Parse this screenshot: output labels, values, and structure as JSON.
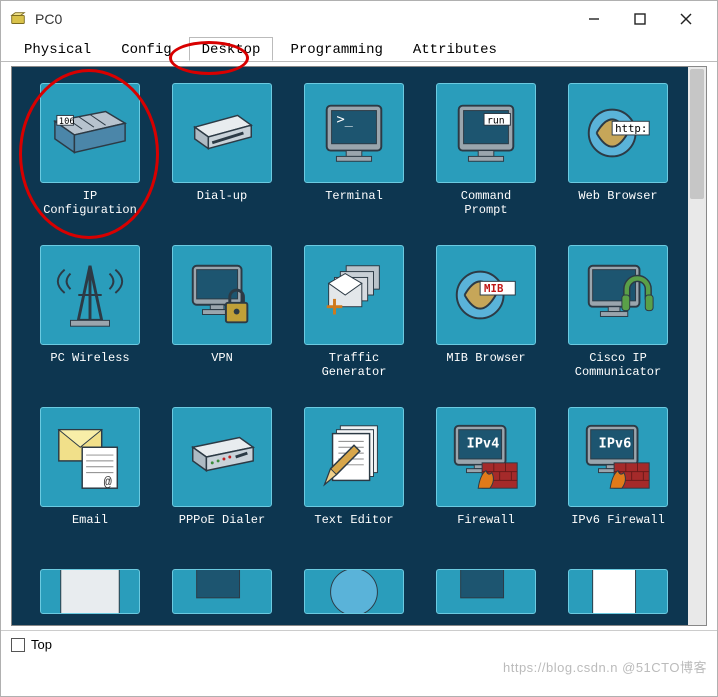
{
  "window": {
    "title": "PC0"
  },
  "tabs": [
    {
      "label": "Physical"
    },
    {
      "label": "Config"
    },
    {
      "label": "Desktop"
    },
    {
      "label": "Programming"
    },
    {
      "label": "Attributes"
    }
  ],
  "active_tab_index": 2,
  "apps": [
    {
      "label": "IP\nConfiguration",
      "icon": "ip-config"
    },
    {
      "label": "Dial-up",
      "icon": "dialup"
    },
    {
      "label": "Terminal",
      "icon": "terminal"
    },
    {
      "label": "Command\nPrompt",
      "icon": "cmd"
    },
    {
      "label": "Web Browser",
      "icon": "browser"
    },
    {
      "label": "PC Wireless",
      "icon": "wireless"
    },
    {
      "label": "VPN",
      "icon": "vpn"
    },
    {
      "label": "Traffic Generator",
      "icon": "traffic"
    },
    {
      "label": "MIB Browser",
      "icon": "mib"
    },
    {
      "label": "Cisco IP\nCommunicator",
      "icon": "ipcomm"
    },
    {
      "label": "Email",
      "icon": "email"
    },
    {
      "label": "PPPoE Dialer",
      "icon": "pppoe"
    },
    {
      "label": "Text Editor",
      "icon": "texteditor"
    },
    {
      "label": "Firewall",
      "icon": "firewall4"
    },
    {
      "label": "IPv6 Firewall",
      "icon": "firewall6"
    }
  ],
  "row4_count": 5,
  "bottom": {
    "top_label": "Top"
  },
  "icon_text": {
    "ip_num": "106",
    "cmd_run": "run",
    "http": "http:",
    "mib": "MIB",
    "ipv4": "IPv4",
    "ipv6": "IPv6"
  },
  "watermark": "https://blog.csdn.n @51CTO博客"
}
